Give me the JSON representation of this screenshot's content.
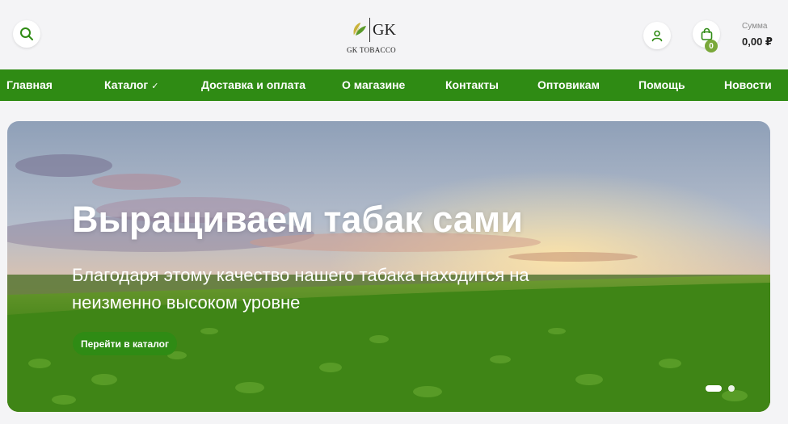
{
  "header": {
    "logo_text": "GK",
    "logo_subtitle": "GK TOBACCO",
    "sum_label": "Сумма",
    "sum_value": "0,00 ₽",
    "cart_count": "0",
    "icons": {
      "search": "search-icon",
      "account": "user-icon",
      "cart": "shopping-bag-icon"
    }
  },
  "nav": {
    "items": [
      {
        "label": "Главная"
      },
      {
        "label": "Каталог",
        "suffix": "✓"
      },
      {
        "label": "Доставка и оплата"
      },
      {
        "label": "О магазине"
      },
      {
        "label": "Контакты"
      },
      {
        "label": "Оптовикам"
      },
      {
        "label": "Помощь"
      },
      {
        "label": "Новости"
      }
    ]
  },
  "hero": {
    "title": "Выращиваем табак сами",
    "subtitle": "Благодаря этому качество нашего табака находится на неизменно высоком уровне",
    "button_label": "Перейти в каталог",
    "slides_total": 2,
    "active_slide": 1
  },
  "colors": {
    "brand_green": "#2f8b14",
    "badge_green": "#7aa83a",
    "page_bg": "#f4f4f6"
  }
}
